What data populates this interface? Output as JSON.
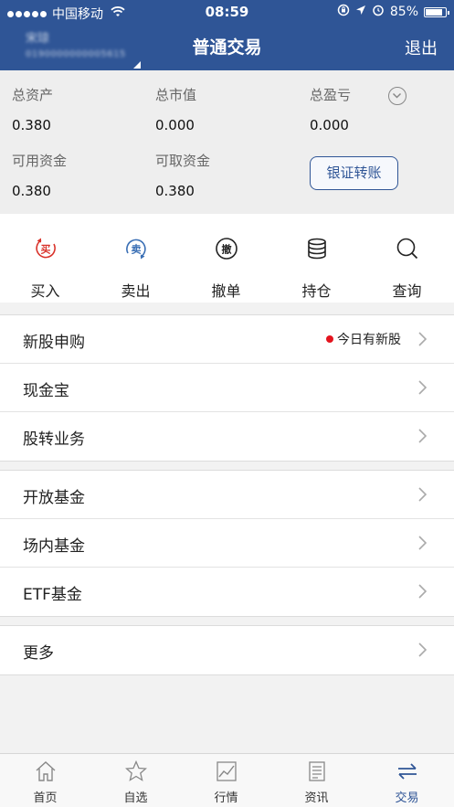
{
  "status_bar": {
    "carrier": "中国移动",
    "time": "08:59",
    "battery": "85%",
    "battery_level": 0.85
  },
  "header": {
    "title": "普通交易",
    "exit_label": "退出",
    "account_name": "宋琼",
    "account_number": "0190000000005615"
  },
  "summary": {
    "total_assets_label": "总资产",
    "total_assets": "0.380",
    "market_value_label": "总市值",
    "market_value": "0.000",
    "total_pl_label": "总盈亏",
    "total_pl": "0.000",
    "available_label": "可用资金",
    "available": "0.380",
    "withdrawable_label": "可取资金",
    "withdrawable": "0.380",
    "transfer_button": "银证转账"
  },
  "actions": [
    {
      "label": "买入",
      "icon": "buy-icon"
    },
    {
      "label": "卖出",
      "icon": "sell-icon"
    },
    {
      "label": "撤单",
      "icon": "cancel-order-icon"
    },
    {
      "label": "持仓",
      "icon": "holdings-icon"
    },
    {
      "label": "查询",
      "icon": "search-icon"
    }
  ],
  "menu_group_1": [
    {
      "label": "新股申购",
      "badge": "今日有新股"
    },
    {
      "label": "现金宝"
    },
    {
      "label": "股转业务"
    }
  ],
  "menu_group_2": [
    {
      "label": "开放基金"
    },
    {
      "label": "场内基金"
    },
    {
      "label": "ETF基金"
    }
  ],
  "menu_group_3": [
    {
      "label": "更多"
    }
  ],
  "tabbar": [
    {
      "label": "首页",
      "icon": "home-icon"
    },
    {
      "label": "自选",
      "icon": "star-icon"
    },
    {
      "label": "行情",
      "icon": "market-chart-icon"
    },
    {
      "label": "资讯",
      "icon": "news-icon"
    },
    {
      "label": "交易",
      "icon": "trade-arrows-icon",
      "active": true
    }
  ],
  "colors": {
    "primary": "#2f5596",
    "badge_red": "#e4141e",
    "buy_red": "#d9322a",
    "sell_blue": "#3a6fb5"
  }
}
